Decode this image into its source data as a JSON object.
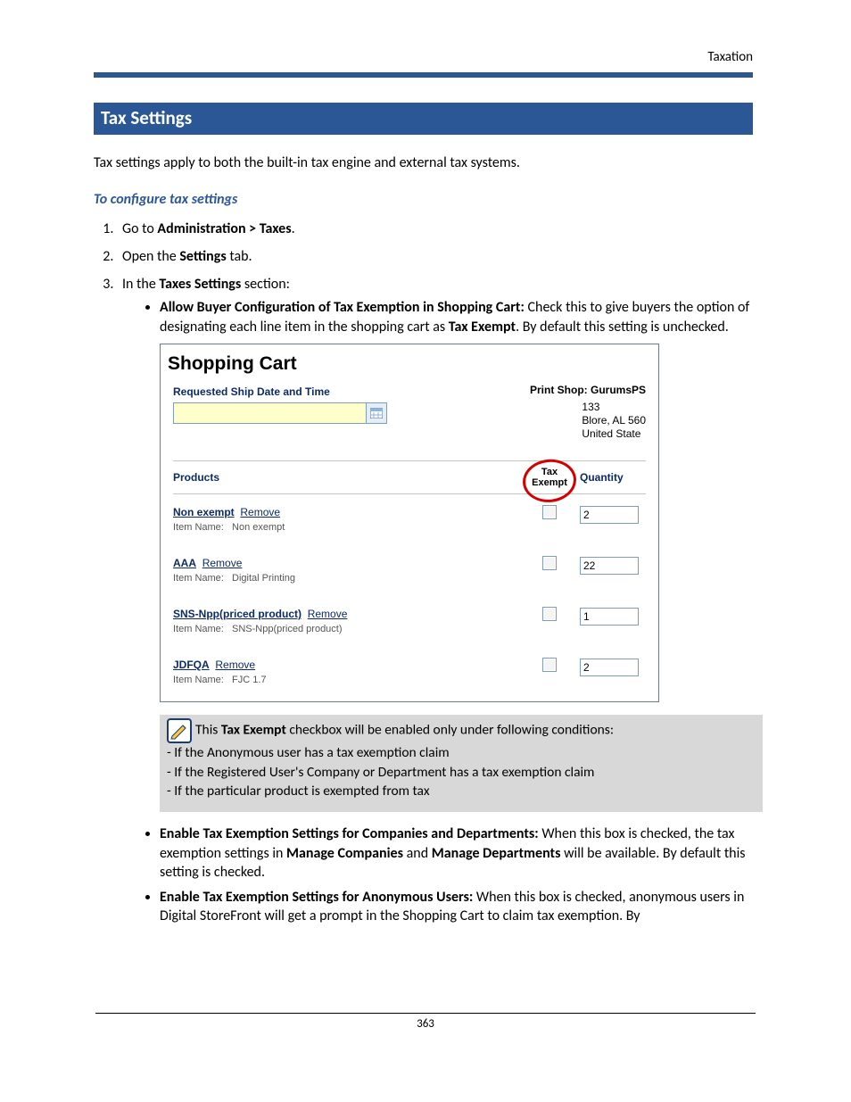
{
  "header": {
    "running": "Taxation"
  },
  "section": {
    "title": "Tax Settings"
  },
  "intro": "Tax settings apply to both the built-in tax engine and external tax systems.",
  "subhead": "To configure tax settings",
  "steps": {
    "s1_a": "Go to ",
    "s1_b": "Administration > Taxes",
    "s1_c": ".",
    "s2_a": "Open the ",
    "s2_b": "Settings",
    "s2_c": " tab.",
    "s3_a": "In the ",
    "s3_b": "Taxes Settings",
    "s3_c": " section:"
  },
  "bullet1": {
    "bold": "Allow Buyer Configuration of Tax Exemption in Shopping Cart:",
    "t1": " Check this to give buyers the option of designating each line item in the shopping cart as ",
    "b2": "Tax Exempt",
    "t2": ". By default this setting is unchecked."
  },
  "shot": {
    "title": "Shopping Cart",
    "ship_label": "Requested Ship Date and Time",
    "printshop_label": "Print Shop:  ",
    "printshop_value": "GurumsPS",
    "addr1": "133",
    "addr2": "Blore, AL 560",
    "addr3": "United State",
    "head_products": "Products",
    "head_tax_l1": "Tax",
    "head_tax_l2": "Exempt",
    "head_qty": "Quantity",
    "item_name_label": "Item Name:",
    "remove": "Remove",
    "rows": [
      {
        "name": "Non exempt",
        "item": "Non exempt",
        "qty": "2"
      },
      {
        "name": "AAA",
        "item": "Digital Printing",
        "qty": "22"
      },
      {
        "name": "SNS-Npp(priced product)",
        "item": "SNS-Npp(priced product)",
        "qty": "1"
      },
      {
        "name": "JDFQA",
        "item": "FJC 1.7",
        "qty": "2"
      }
    ]
  },
  "note": {
    "l1a": "This ",
    "l1b": "Tax Exempt",
    "l1c": " checkbox will be enabled only under following conditions:",
    "l2": "- If the Anonymous user has a tax exemption claim",
    "l3": "- If the Registered User's Company or Department has a tax exemption claim",
    "l4": "- If the particular product is exempted from tax"
  },
  "bullet2": {
    "bold": "Enable Tax Exemption Settings for Companies and Departments:",
    "t1": " When this box is checked, the tax exemption settings in ",
    "b2": "Manage Companies",
    "t2": " and ",
    "b3": "Manage Departments",
    "t3": " will be available. By default this setting is checked."
  },
  "bullet3": {
    "bold": "Enable Tax Exemption Settings for Anonymous Users:",
    "t1": " When this box is checked, anonymous users in Digital StoreFront will get a prompt in the Shopping Cart to claim tax exemption. By"
  },
  "pagenum": "363"
}
